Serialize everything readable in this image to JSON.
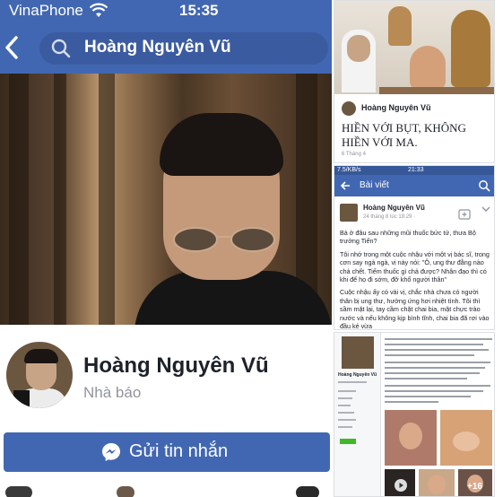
{
  "status_bar": {
    "carrier": "VinaPhone",
    "time": "15:35"
  },
  "search": {
    "query": "Hoàng Nguyên Vũ"
  },
  "profile": {
    "name": "Hoàng Nguyên Vũ",
    "role": "Nhà báo",
    "message_button": "Gửi tin nhắn"
  },
  "right_post": {
    "author": "Hoàng Nguyên Vũ",
    "title": "HIỀN VỚI BỤT, KHÔNG HIỀN VỚI MA.",
    "meta": "6 Tháng 4"
  },
  "post_view": {
    "status_left": "7.5/KB/s",
    "status_time": "21:33",
    "nav_title": "Bài viết",
    "author": "Hoàng Nguyên Vũ",
    "date": "24 tháng 8 lúc 18:29 ·",
    "paragraphs": [
      "Bà ở đâu sau những mũi thuốc bức tử, thưa Bộ trưởng Tiến?",
      "Tôi nhớ trong một cuộc nhậu với một vị bác sĩ, trong cơn say ngà ngà, vị này nói: \"Ô, ung thư đằng nào chả chết. Tiếm thuốc gì chả được? Nhân đạo thì có khi để họ đi sớm, đỡ khổ người thân\"",
      "Cuộc nhậu ấy có vài vị, chắc nhà chưa có người thân bị ung thư, hưởng ứng hơi nhiệt tình. Tôi thì sầm mặt lại, tay cầm chặt chai bia, mặt chực trào nước và nếu không kịp bình tĩnh, chai bia đã rơi vào đầu kẻ vừa"
    ]
  },
  "collage": {
    "author": "Hoàng Nguyên Vũ",
    "more_count": "+16"
  }
}
